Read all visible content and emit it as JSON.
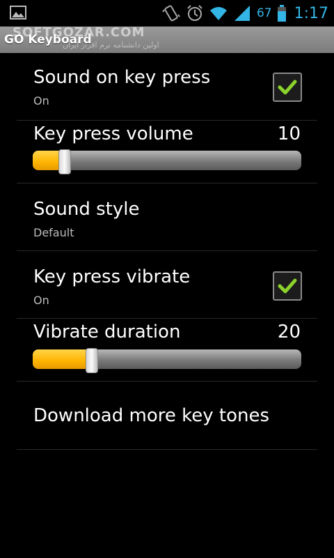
{
  "status_bar": {
    "battery_percent": "67",
    "time": "1:17",
    "icons": [
      "gallery-icon",
      "vibrate-icon",
      "alarm-icon",
      "wifi-icon",
      "signal-icon"
    ]
  },
  "title_bar": {
    "title": "GO Keyboard",
    "watermark": "SOFTGOZAR.COM",
    "watermark_sub": "اولین دانشنامه نرم افزار ایران"
  },
  "settings": {
    "sound_on_key_press": {
      "title": "Sound on key press",
      "summary": "On",
      "checked": true
    },
    "key_press_volume": {
      "title": "Key press volume",
      "value": "10",
      "fill_fraction": 0.12
    },
    "sound_style": {
      "title": "Sound style",
      "summary": "Default"
    },
    "key_press_vibrate": {
      "title": "Key press vibrate",
      "summary": "On",
      "checked": true
    },
    "vibrate_duration": {
      "title": "Vibrate duration",
      "value": "20",
      "fill_fraction": 0.22
    },
    "download_key_tones": {
      "title": "Download more key tones"
    }
  },
  "colors": {
    "accent_blue": "#33b5e5",
    "check_green": "#8bd22c",
    "slider_yellow": "#ffb300"
  }
}
